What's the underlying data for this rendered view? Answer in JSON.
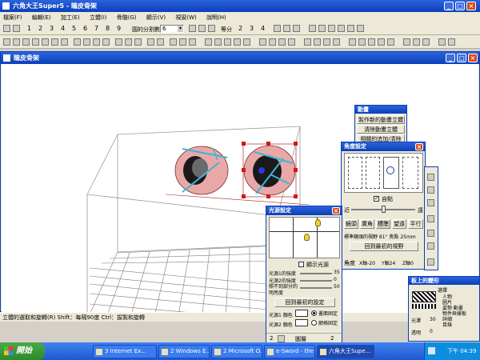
{
  "app": {
    "title": "六角大王Super5 - 瞳皮骨架",
    "menu": [
      "檔案(F)",
      "編輯(E)",
      "加工(E)",
      "立體(I)",
      "骨骼(G)",
      "顯示(V)",
      "視窗(W)",
      "說明(H)"
    ],
    "toolbar_numbers": [
      "1",
      "2",
      "3",
      "4",
      "5",
      "6",
      "7",
      "8",
      "9"
    ],
    "circle_label": "圓的分割數",
    "circle_value": "6",
    "divide_label": "等分",
    "divide_numbers": [
      "2",
      "3",
      "4"
    ]
  },
  "doc": {
    "title": "瞳皮骨架"
  },
  "status": {
    "text": "立體的選取和旋轉(R)  Shift：每隔90度  Ctrl：拔製和旋轉"
  },
  "anim_panel": {
    "title": "動畫",
    "buttons": [
      "製作新的動畫立體",
      "清除動畫立體",
      "相關的追加/清除"
    ]
  },
  "angle_panel": {
    "title": "角度設定",
    "checkbox": "自點",
    "near": "近",
    "far": "遠",
    "buttons": [
      "鏡頭",
      "廣角",
      "標準",
      "望遠",
      "平行"
    ],
    "zoom_text": "標準鏡頭的視野 81° 焦點 25mm",
    "reset": "回到最初的視野",
    "angle_label": "角度",
    "x": "X軸-20",
    "y": "Y軸24",
    "z": "Z軸0"
  },
  "light_panel": {
    "title": "光源設定",
    "show_light": "顯示光源",
    "l1_strength": "光源1的強度",
    "l2_strength": "光源2的強度",
    "ambient": "照不到部分的明亮度",
    "v1": "35",
    "v2": "0",
    "v3": "50",
    "reset": "回到最初的設定",
    "l1_color": "光源1 顏色",
    "l2_color": "光源2 顏色",
    "fixed_screen": "畫面固定",
    "fixed_grid": "網格固定",
    "bottom_left": "2",
    "bottom_mid": "圖層",
    "bottom_right": "2"
  },
  "props_panel": {
    "title": "板上的變形",
    "sub": "選擇",
    "tree": [
      "人物",
      "圖片",
      "姿勢‧動畫",
      "物件與樣板",
      "詳細",
      "目錄"
    ],
    "slider1": "光澤",
    "slider1_val": "30",
    "slider2": "透明",
    "slider2_val": "0"
  },
  "taskbar": {
    "start": "開始",
    "items": [
      "3 Internet Ex...",
      "2 Windows E...",
      "2 Microsoft O...",
      "e-Sword - the S...",
      "六角大王Supe..."
    ],
    "clock": "下午 04:39"
  }
}
